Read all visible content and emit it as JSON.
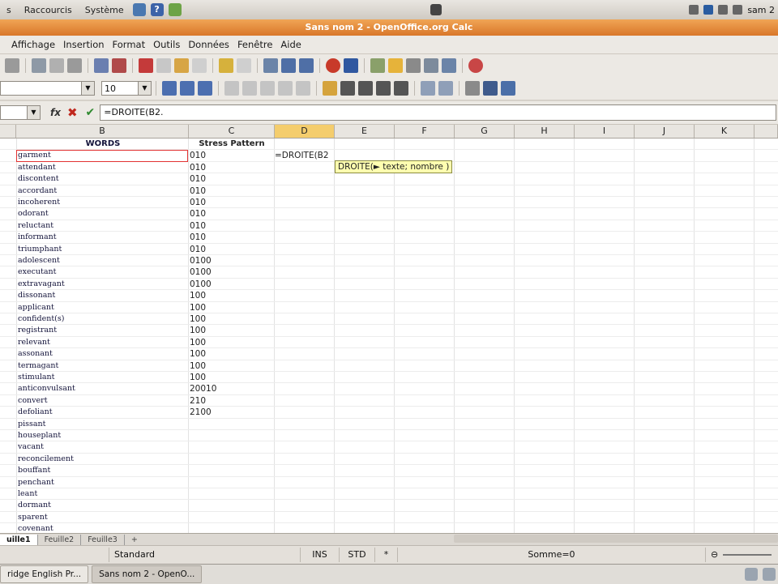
{
  "top_panel": {
    "menus": [
      "s",
      "Raccourcis",
      "Système"
    ],
    "clock": "sam 2"
  },
  "window": {
    "title": "Sans nom 2 - OpenOffice.org Calc"
  },
  "menubar": [
    "Affichage",
    "Insertion",
    "Format",
    "Outils",
    "Données",
    "Fenêtre",
    "Aide"
  ],
  "toolbar2": {
    "font_size": "10"
  },
  "formula_bar": {
    "fx_label": "fx",
    "formula": "=DROITE(B2."
  },
  "columns": [
    "B",
    "C",
    "D",
    "E",
    "F",
    "G",
    "H",
    "I",
    "J",
    "K"
  ],
  "active_column": "D",
  "table": {
    "headers": {
      "words": "WORDS",
      "stress": "Stress Pattern"
    },
    "rows": [
      {
        "word": "garment",
        "stress": "010"
      },
      {
        "word": "attendant",
        "stress": "010"
      },
      {
        "word": "discontent",
        "stress": "010"
      },
      {
        "word": "accordant",
        "stress": "010"
      },
      {
        "word": "incoherent",
        "stress": "010"
      },
      {
        "word": "odorant",
        "stress": "010"
      },
      {
        "word": "reluctant",
        "stress": "010"
      },
      {
        "word": "informant",
        "stress": "010"
      },
      {
        "word": "triumphant",
        "stress": "010"
      },
      {
        "word": "adolescent",
        "stress": "0100"
      },
      {
        "word": "executant",
        "stress": "0100"
      },
      {
        "word": "extravagant",
        "stress": "0100"
      },
      {
        "word": "dissonant",
        "stress": "100"
      },
      {
        "word": "applicant",
        "stress": "100"
      },
      {
        "word": "confident(s)",
        "stress": "100"
      },
      {
        "word": "registrant",
        "stress": "100"
      },
      {
        "word": "relevant",
        "stress": "100"
      },
      {
        "word": "assonant",
        "stress": "100"
      },
      {
        "word": "termagant",
        "stress": "100"
      },
      {
        "word": "stimulant",
        "stress": "100"
      },
      {
        "word": "anticonvulsant",
        "stress": "20010"
      },
      {
        "word": "convert",
        "stress": "210"
      },
      {
        "word": "defoliant",
        "stress": "2100"
      },
      {
        "word": "pissant",
        "stress": ""
      },
      {
        "word": "houseplant",
        "stress": ""
      },
      {
        "word": "vacant",
        "stress": ""
      },
      {
        "word": "reconcilement",
        "stress": ""
      },
      {
        "word": "bouffant",
        "stress": ""
      },
      {
        "word": "penchant",
        "stress": ""
      },
      {
        "word": "leant",
        "stress": ""
      },
      {
        "word": "dormant",
        "stress": ""
      },
      {
        "word": "sparent",
        "stress": ""
      },
      {
        "word": "covenant",
        "stress": ""
      }
    ]
  },
  "editing": {
    "cell_text": "=DROITE(B2",
    "tooltip": "DROITE(► texte; nombre )"
  },
  "sheet_tabs": [
    "uille1",
    "Feuille2",
    "Feuille3"
  ],
  "statusbar": {
    "style": "Standard",
    "ins": "INS",
    "std": "STD",
    "star": "*",
    "sum": "Somme=0"
  },
  "taskbar": [
    "ridge English Pr...",
    "Sans nom 2 - OpenO..."
  ]
}
